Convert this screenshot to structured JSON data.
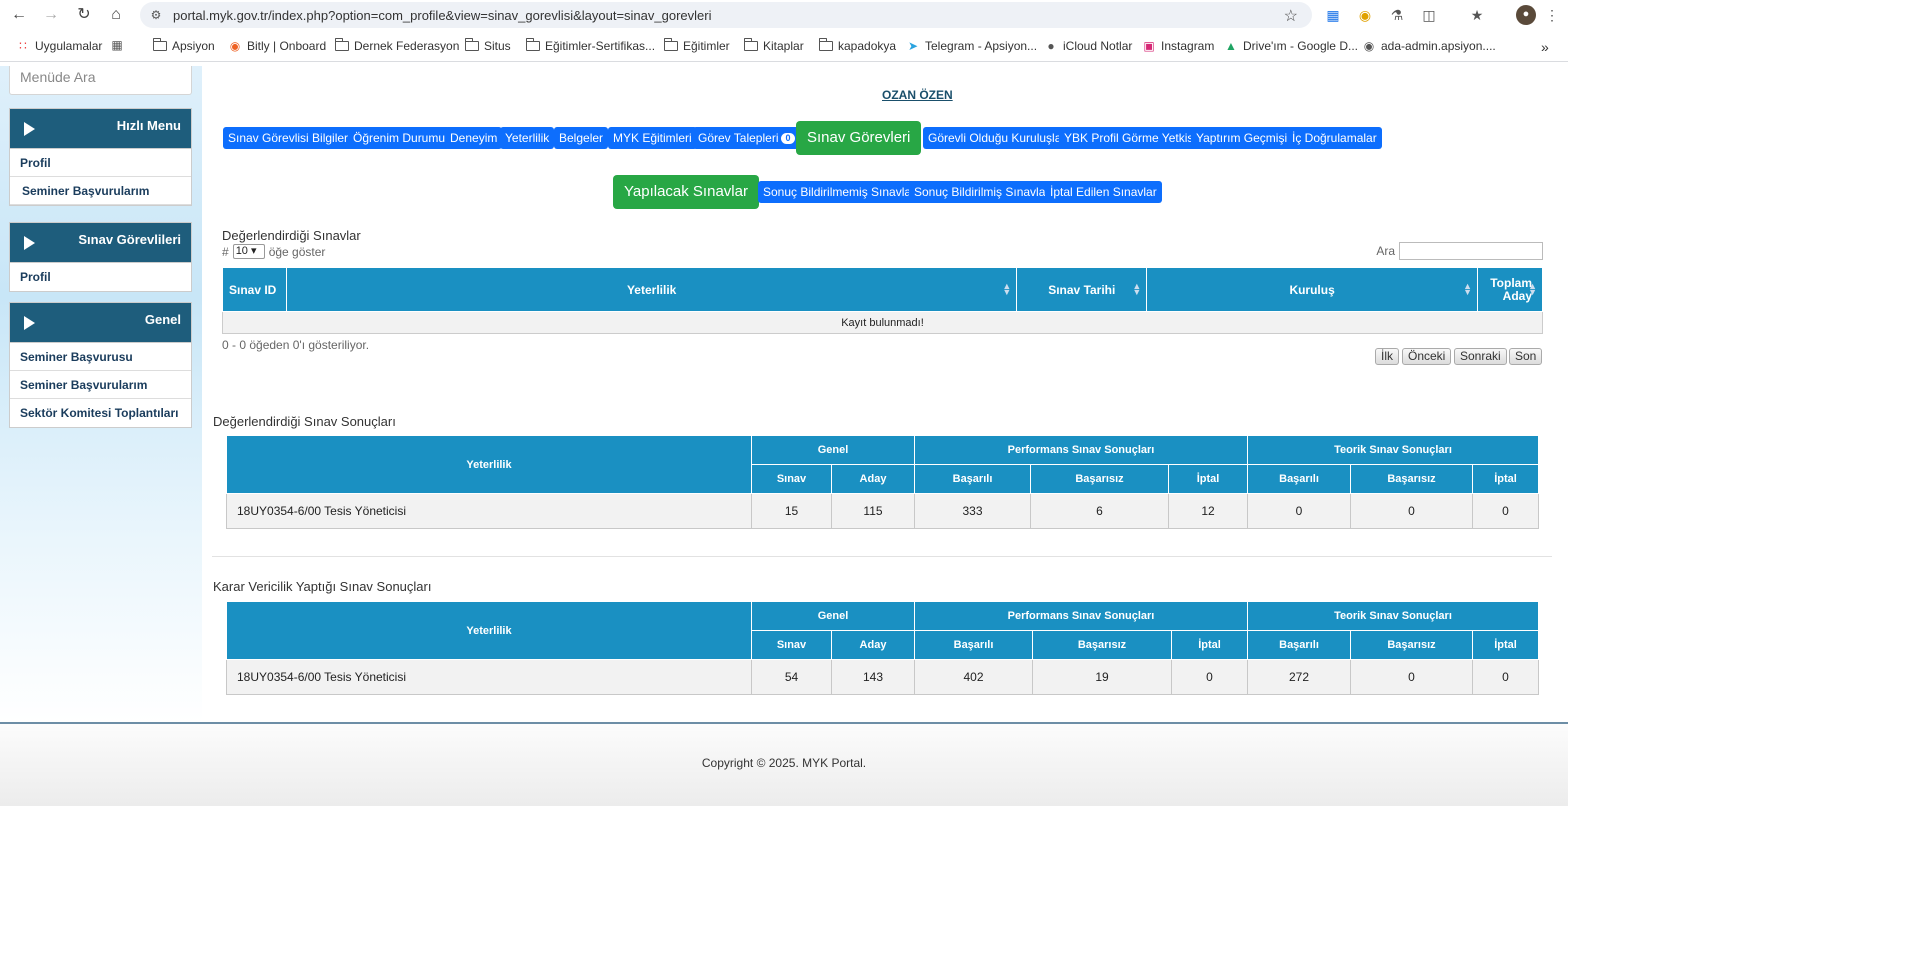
{
  "browser": {
    "url": "portal.myk.gov.tr/index.php?option=com_profile&view=sinav_gorevlisi&layout=sinav_gorevleri",
    "bookmarks": [
      {
        "label": "Uygulamalar",
        "icon": "apps-grid-icon"
      },
      {
        "label": "",
        "icon": "tab-groups-icon"
      },
      {
        "label": "Apsiyon",
        "icon": "folder-icon"
      },
      {
        "label": "Bitly | Onboard",
        "icon": "bitly-icon"
      },
      {
        "label": "Dernek Federasyon",
        "icon": "folder-icon"
      },
      {
        "label": "Situs",
        "icon": "folder-icon"
      },
      {
        "label": "Eğitimler-Sertifikas...",
        "icon": "folder-icon"
      },
      {
        "label": "Eğitimler",
        "icon": "folder-icon"
      },
      {
        "label": "Kitaplar",
        "icon": "folder-icon"
      },
      {
        "label": "kapadokya",
        "icon": "folder-icon"
      },
      {
        "label": "Telegram - Apsiyon...",
        "icon": "telegram-icon"
      },
      {
        "label": "iCloud Notlar",
        "icon": "apple-icon"
      },
      {
        "label": "Instagram",
        "icon": "instagram-icon"
      },
      {
        "label": "Drive'ım - Google D...",
        "icon": "google-drive-icon"
      },
      {
        "label": "ada-admin.apsiyon....",
        "icon": "globe-icon"
      }
    ]
  },
  "sidebar": {
    "search_placeholder": "Menüde Ara",
    "panels": [
      {
        "title": "Hızlı Menu",
        "items": [
          "Profil",
          "Seminer Başvurularım"
        ]
      },
      {
        "title": "Sınav Görevlileri",
        "items": [
          "Profil"
        ]
      },
      {
        "title": "Genel",
        "items": [
          "Seminer Başvurusu",
          "Seminer Başvurularım",
          "Sektör Komitesi Toplantıları"
        ]
      }
    ]
  },
  "profile": {
    "name": "OZAN ÖZEN"
  },
  "tabs": [
    {
      "label": "Sınav Görevlisi Bilgileri"
    },
    {
      "label": "Öğrenim Durumu"
    },
    {
      "label": "Deneyim"
    },
    {
      "label": "Yeterlilik"
    },
    {
      "label": "Belgeler"
    },
    {
      "label": "MYK Eğitimleri"
    },
    {
      "label": "Görev Talepleri",
      "badge": "0"
    },
    {
      "label": "Sınav Görevleri",
      "active": true
    },
    {
      "label": "Görevli Olduğu Kuruluşlar"
    },
    {
      "label": "YBK Profil Görme Yetkisi"
    },
    {
      "label": "Yaptırım Geçmişi"
    },
    {
      "label": "İç Doğrulamalar"
    }
  ],
  "subtabs": [
    {
      "label": "Yapılacak Sınavlar",
      "active": true
    },
    {
      "label": "Sonuç Bildirilmemiş Sınavlar"
    },
    {
      "label": "Sonuç Bildirilmiş Sınavlar"
    },
    {
      "label": "İptal Edilen Sınavlar"
    }
  ],
  "exams_table": {
    "title": "Değerlendirdiği Sınavlar",
    "length_prefix": "#",
    "length_value": "10",
    "length_suffix": "öğe göster",
    "search_label": "Ara",
    "columns": [
      "Sınav ID",
      "Yeterlilik",
      "Sınav Tarihi",
      "Kuruluş",
      "Toplam Aday"
    ],
    "empty_text": "Kayıt bulunmadı!",
    "info": "0 - 0 öğeden 0'ı gösteriliyor.",
    "pagination": [
      "İlk",
      "Önceki",
      "Sonraki",
      "Son"
    ]
  },
  "result_headers": {
    "qualification": "Yeterlilik",
    "groups": [
      "Genel",
      "Performans Sınav Sonuçları",
      "Teorik Sınav Sonuçları"
    ],
    "sub": [
      "Sınav",
      "Aday",
      "Başarılı",
      "Başarısız",
      "İptal",
      "Başarılı",
      "Başarısız",
      "İptal"
    ]
  },
  "results_evaluated": {
    "title": "Değerlendirdiği Sınav Sonuçları",
    "row": {
      "qualification": "18UY0354-6/00 Tesis Yöneticisi",
      "values": [
        "15",
        "115",
        "333",
        "6",
        "12",
        "0",
        "0",
        "0"
      ]
    }
  },
  "results_decision": {
    "title": "Karar Vericilik Yaptığı Sınav Sonuçları",
    "row": {
      "qualification": "18UY0354-6/00 Tesis Yöneticisi",
      "values": [
        "54",
        "143",
        "402",
        "19",
        "0",
        "272",
        "0",
        "0"
      ]
    }
  },
  "footer": {
    "copyright": "Copyright © 2025. MYK Portal."
  }
}
